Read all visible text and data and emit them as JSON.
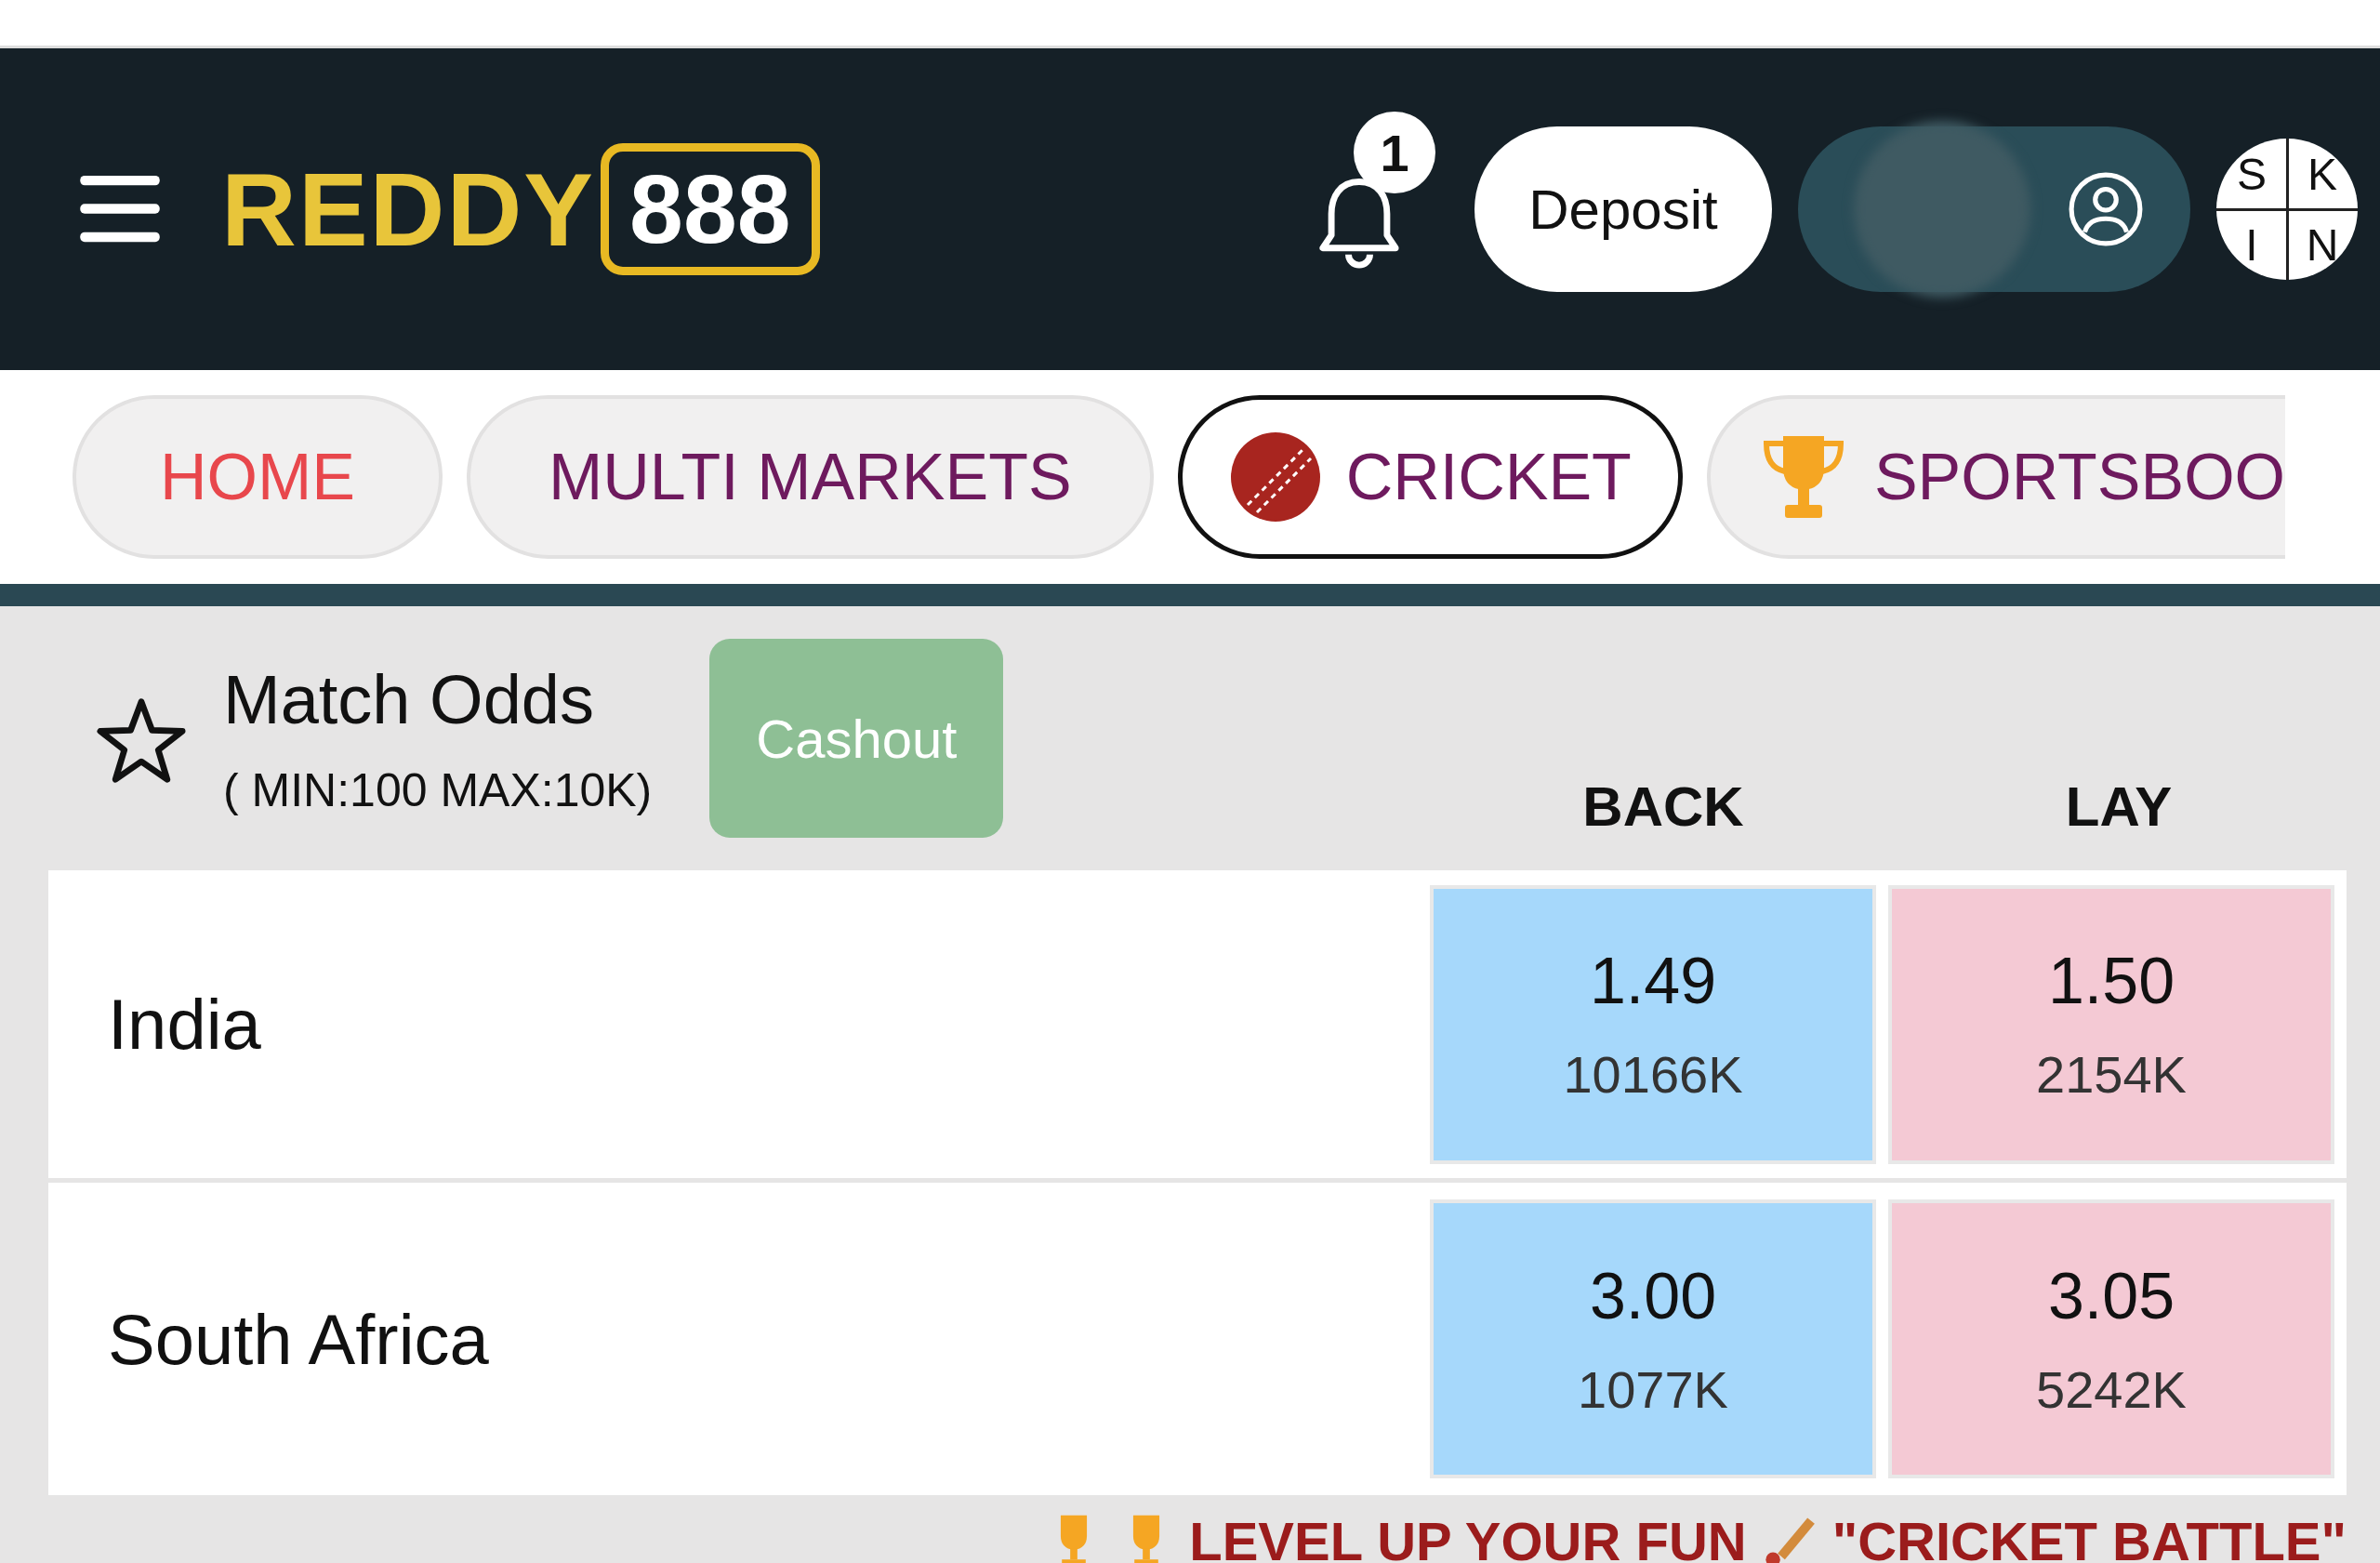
{
  "header": {
    "logo": {
      "word": "REDDY",
      "number": "888"
    },
    "notifications": {
      "count": "1"
    },
    "deposit_button": "Deposit",
    "skin_button": [
      "S",
      "K",
      "I",
      "N"
    ]
  },
  "nav": [
    {
      "label": "HOME",
      "kind": "text",
      "color": "#e8474c",
      "selected": false
    },
    {
      "label": "MULTI MARKETS",
      "kind": "text",
      "color": "#6e1a5e",
      "selected": false
    },
    {
      "label": "CRICKET",
      "kind": "ball",
      "color": "#6e1a5e",
      "selected": true
    },
    {
      "label": "SPORTSBOO",
      "kind": "trophy",
      "color": "#6e1a5e",
      "selected": false
    }
  ],
  "market": {
    "title": "Match Odds",
    "limits": "( MIN:100 MAX:10K)",
    "cashout_button": "Cashout",
    "columns": [
      "BACK",
      "LAY"
    ],
    "rows": [
      {
        "team": "India",
        "back": {
          "odds": "1.49",
          "volume": "10166K"
        },
        "lay": {
          "odds": "1.50",
          "volume": "2154K"
        }
      },
      {
        "team": "South Africa",
        "back": {
          "odds": "3.00",
          "volume": "1077K"
        },
        "lay": {
          "odds": "3.05",
          "volume": "5242K"
        }
      }
    ]
  },
  "banner": {
    "text": "LEVEL UP YOUR FUN",
    "quote": "\"CRICKET BATTLE\""
  }
}
